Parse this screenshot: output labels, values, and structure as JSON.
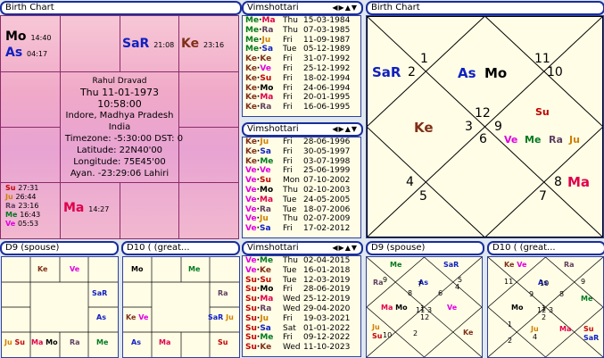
{
  "colors": {
    "ma": "#e0004a",
    "me": "#007a20",
    "ju": "#d08000",
    "sa": "#1020c0",
    "ra": "#604060",
    "ke": "#803018",
    "ve": "#e000e0",
    "su": "#c00000",
    "mo": "#000000",
    "as": "#1020c0",
    "frame": "#1a2e9c"
  },
  "birth_chart_left": {
    "title": "Birth Chart",
    "info": {
      "name": "Rahul Dravad",
      "date": "Thu 11-01-1973",
      "time": "10:58:00",
      "place1": "Indore, Madhya Pradesh",
      "place2": "India",
      "timezone": "Timezone: -5:30:00 DST: 0",
      "latitude": "Latitude: 22N40'00",
      "longitude": "Longitude: 75E45'00",
      "ayan": "Ayan. -23:29:06 Lahiri"
    },
    "mo": {
      "planet": "Mo",
      "deg": "14:40"
    },
    "as": {
      "planet": "As",
      "deg": "04:17"
    },
    "sar": {
      "planet": "SaR",
      "deg": "21:08"
    },
    "ke": {
      "planet": "Ke",
      "deg": "23:16"
    },
    "ma": {
      "planet": "Ma",
      "deg": "14:27"
    },
    "small": [
      {
        "planet": "Su",
        "deg": "27:31",
        "color": "#c00000"
      },
      {
        "planet": "Ju",
        "deg": "26:44",
        "color": "#d08000"
      },
      {
        "planet": "Ra",
        "deg": "23:16",
        "color": "#604060"
      },
      {
        "planet": "Me",
        "deg": "16:43",
        "color": "#007a20"
      },
      {
        "planet": "Ve",
        "deg": "05:53",
        "color": "#e000e0"
      }
    ]
  },
  "vimshottari": [
    {
      "title": "Vimshottari",
      "controls": "◀▶▲▼",
      "rows": [
        {
          "a": "Me",
          "ac": "#007a20",
          "b": "Ma",
          "bc": "#e0004a",
          "day": "Thu",
          "date": "15-03-1984"
        },
        {
          "a": "Me",
          "ac": "#007a20",
          "b": "Ra",
          "bc": "#604060",
          "day": "Thu",
          "date": "07-03-1985"
        },
        {
          "a": "Me",
          "ac": "#007a20",
          "b": "Ju",
          "bc": "#d08000",
          "day": "Fri",
          "date": "11-09-1987"
        },
        {
          "a": "Me",
          "ac": "#007a20",
          "b": "Sa",
          "bc": "#1020c0",
          "day": "Tue",
          "date": "05-12-1989"
        },
        {
          "a": "Ke",
          "ac": "#803018",
          "b": "Ke",
          "bc": "#803018",
          "day": "Fri",
          "date": "31-07-1992"
        },
        {
          "a": "Ke",
          "ac": "#803018",
          "b": "Ve",
          "bc": "#e000e0",
          "day": "Fri",
          "date": "25-12-1992"
        },
        {
          "a": "Ke",
          "ac": "#803018",
          "b": "Su",
          "bc": "#c00000",
          "day": "Fri",
          "date": "18-02-1994"
        },
        {
          "a": "Ke",
          "ac": "#803018",
          "b": "Mo",
          "bc": "#000000",
          "day": "Fri",
          "date": "24-06-1994"
        },
        {
          "a": "Ke",
          "ac": "#803018",
          "b": "Ma",
          "bc": "#e0004a",
          "day": "Fri",
          "date": "20-01-1995"
        },
        {
          "a": "Ke",
          "ac": "#803018",
          "b": "Ra",
          "bc": "#604060",
          "day": "Fri",
          "date": "16-06-1995"
        }
      ]
    },
    {
      "title": "Vimshottari",
      "controls": "◀▶▲▼",
      "rows": [
        {
          "a": "Ke",
          "ac": "#803018",
          "b": "Ju",
          "bc": "#d08000",
          "day": "Fri",
          "date": "28-06-1996"
        },
        {
          "a": "Ke",
          "ac": "#803018",
          "b": "Sa",
          "bc": "#1020c0",
          "day": "Fri",
          "date": "30-05-1997"
        },
        {
          "a": "Ke",
          "ac": "#803018",
          "b": "Me",
          "bc": "#007a20",
          "day": "Fri",
          "date": "03-07-1998"
        },
        {
          "a": "Ve",
          "ac": "#e000e0",
          "b": "Ve",
          "bc": "#e000e0",
          "day": "Fri",
          "date": "25-06-1999"
        },
        {
          "a": "Ve",
          "ac": "#e000e0",
          "b": "Su",
          "bc": "#c00000",
          "day": "Mon",
          "date": "07-10-2002"
        },
        {
          "a": "Ve",
          "ac": "#e000e0",
          "b": "Mo",
          "bc": "#000000",
          "day": "Thu",
          "date": "02-10-2003"
        },
        {
          "a": "Ve",
          "ac": "#e000e0",
          "b": "Ma",
          "bc": "#e0004a",
          "day": "Tue",
          "date": "24-05-2005"
        },
        {
          "a": "Ve",
          "ac": "#e000e0",
          "b": "Ra",
          "bc": "#604060",
          "day": "Tue",
          "date": "18-07-2006"
        },
        {
          "a": "Ve",
          "ac": "#e000e0",
          "b": "Ju",
          "bc": "#d08000",
          "day": "Thu",
          "date": "02-07-2009"
        },
        {
          "a": "Ve",
          "ac": "#e000e0",
          "b": "Sa",
          "bc": "#1020c0",
          "day": "Fri",
          "date": "17-02-2012"
        }
      ]
    },
    {
      "title": "Vimshottari",
      "controls": "◀▶▲▼",
      "rows": [
        {
          "a": "Ve",
          "ac": "#e000e0",
          "b": "Me",
          "bc": "#007a20",
          "day": "Thu",
          "date": "02-04-2015"
        },
        {
          "a": "Ve",
          "ac": "#e000e0",
          "b": "Ke",
          "bc": "#803018",
          "day": "Tue",
          "date": "16-01-2018"
        },
        {
          "a": "Su",
          "ac": "#c00000",
          "b": "Su",
          "bc": "#c00000",
          "day": "Tue",
          "date": "12-03-2019"
        },
        {
          "a": "Su",
          "ac": "#c00000",
          "b": "Mo",
          "bc": "#000000",
          "day": "Fri",
          "date": "28-06-2019"
        },
        {
          "a": "Su",
          "ac": "#c00000",
          "b": "Ma",
          "bc": "#e0004a",
          "day": "Wed",
          "date": "25-12-2019"
        },
        {
          "a": "Su",
          "ac": "#c00000",
          "b": "Ra",
          "bc": "#604060",
          "day": "Wed",
          "date": "29-04-2020"
        },
        {
          "a": "Su",
          "ac": "#c00000",
          "b": "Ju",
          "bc": "#d08000",
          "day": "Fri",
          "date": "19-03-2021"
        },
        {
          "a": "Su",
          "ac": "#c00000",
          "b": "Sa",
          "bc": "#1020c0",
          "day": "Sat",
          "date": "01-01-2022"
        },
        {
          "a": "Su",
          "ac": "#c00000",
          "b": "Me",
          "bc": "#007a20",
          "day": "Fri",
          "date": "09-12-2022"
        },
        {
          "a": "Su",
          "ac": "#c00000",
          "b": "Ke",
          "bc": "#803018",
          "day": "Wed",
          "date": "11-10-2023"
        }
      ]
    }
  ],
  "birth_chart_right": {
    "title": "Birth Chart",
    "numbers": [
      "1",
      "2",
      "3",
      "4",
      "5",
      "6",
      "7",
      "8",
      "9",
      "10",
      "11",
      "12"
    ],
    "planets": {
      "sar": "SaR",
      "as": "As",
      "mo": "Mo",
      "ke": "Ke",
      "su": "Su",
      "ve": "Ve",
      "me": "Me",
      "ra": "Ra",
      "ju": "Ju",
      "ma": "Ma"
    }
  },
  "d9_left": {
    "title": "D9  (spouse)",
    "cells": {
      "top": [
        {
          "t": "Ke",
          "c": "#803018"
        },
        {
          "t": "Ve",
          "c": "#e000e0"
        }
      ],
      "right_upper": [
        {
          "t": "SaR",
          "c": "#1020c0"
        }
      ],
      "right_mid": [
        {
          "t": "As",
          "c": "#1020c0"
        }
      ],
      "bottom": [
        {
          "t": "Ju",
          "c": "#d08000"
        },
        {
          "t": "Su",
          "c": "#c00000"
        },
        {
          "t": "Ma",
          "c": "#e0004a"
        },
        {
          "t": "Mo",
          "c": "#000000"
        },
        {
          "t": "Ra",
          "c": "#604060"
        },
        {
          "t": "Me",
          "c": "#007a20"
        }
      ]
    }
  },
  "d10_left": {
    "title": "D10 ( (great...",
    "cells": {
      "top": [
        {
          "t": "Mo",
          "c": "#000000"
        },
        {
          "t": "Me",
          "c": "#007a20"
        }
      ],
      "right_upper": [
        {
          "t": "Ra",
          "c": "#604060"
        }
      ],
      "left_mid": [
        {
          "t": "Ke",
          "c": "#803018"
        },
        {
          "t": "Ve",
          "c": "#e000e0"
        }
      ],
      "right_mid": [
        {
          "t": "SaR",
          "c": "#1020c0"
        },
        {
          "t": "Ju",
          "c": "#d08000"
        }
      ],
      "bottom": [
        {
          "t": "As",
          "c": "#1020c0"
        },
        {
          "t": "Ma",
          "c": "#e0004a"
        },
        {
          "t": "Su",
          "c": "#c00000"
        }
      ]
    }
  },
  "d9_right": {
    "title": "D9  (spouse)",
    "labels": [
      {
        "t": "Me",
        "c": "#007a20"
      },
      {
        "t": "SaR",
        "c": "#1020c0"
      },
      {
        "t": "Ra",
        "c": "#604060"
      },
      {
        "t": "As",
        "c": "#1020c0"
      },
      {
        "t": "Ma",
        "c": "#e0004a"
      },
      {
        "t": "Mo",
        "c": "#000000"
      },
      {
        "t": "Ve",
        "c": "#e000e0"
      },
      {
        "t": "Ju",
        "c": "#d08000"
      },
      {
        "t": "Su",
        "c": "#c00000"
      },
      {
        "t": "Ke",
        "c": "#803018"
      }
    ],
    "numbers": [
      "1",
      "2",
      "3",
      "4",
      "5",
      "6",
      "7",
      "8",
      "9",
      "10",
      "11",
      "12"
    ]
  },
  "d10_right": {
    "title": "D10 ( (great...",
    "labels": [
      {
        "t": "Ke",
        "c": "#803018"
      },
      {
        "t": "Ve",
        "c": "#e000e0"
      },
      {
        "t": "Ra",
        "c": "#604060"
      },
      {
        "t": "As",
        "c": "#1020c0"
      },
      {
        "t": "Mo",
        "c": "#000000"
      },
      {
        "t": "Me",
        "c": "#007a20"
      },
      {
        "t": "Ju",
        "c": "#d08000"
      },
      {
        "t": "Ma",
        "c": "#e0004a"
      },
      {
        "t": "Su",
        "c": "#c00000"
      },
      {
        "t": "SaR",
        "c": "#1020c0"
      }
    ],
    "numbers": [
      "1",
      "2",
      "3",
      "4",
      "5",
      "6",
      "7",
      "8",
      "9",
      "10",
      "11",
      "12"
    ]
  }
}
